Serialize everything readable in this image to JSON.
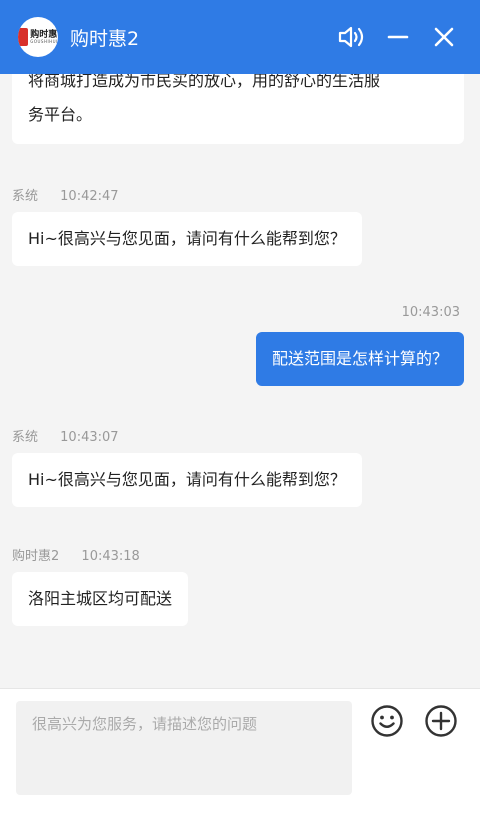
{
  "header": {
    "title": "购时惠2",
    "logo_text": "购时惠",
    "logo_sub": "GOUSHIHUI"
  },
  "messages": [
    {
      "type": "received-partial",
      "text_line1": "将商城打造成为市民买的放心，用的舒心的生活服",
      "text_line2": "务平台。"
    },
    {
      "type": "received",
      "sender": "系统",
      "time": "10:42:47",
      "text": "Hi~很高兴与您见面，请问有什么能帮到您？"
    },
    {
      "type": "sent",
      "time": "10:43:03",
      "text": "配送范围是怎样计算的？"
    },
    {
      "type": "received",
      "sender": "系统",
      "time": "10:43:07",
      "text": "Hi~很高兴与您见面，请问有什么能帮到您？"
    },
    {
      "type": "received",
      "sender": "购时惠2",
      "time": "10:43:18",
      "text": "洛阳主城区均可配送"
    }
  ],
  "composer": {
    "placeholder": "很高兴为您服务，请描述您的问题"
  },
  "icons": {
    "sound": "volume-icon",
    "minimize": "minimize-icon",
    "close": "close-icon",
    "emoji": "emoji-icon",
    "add": "add-icon"
  },
  "colors": {
    "primary": "#2f7be5",
    "background": "#f4f4f4",
    "bubble_received": "#ffffff",
    "meta_text": "#999999"
  }
}
